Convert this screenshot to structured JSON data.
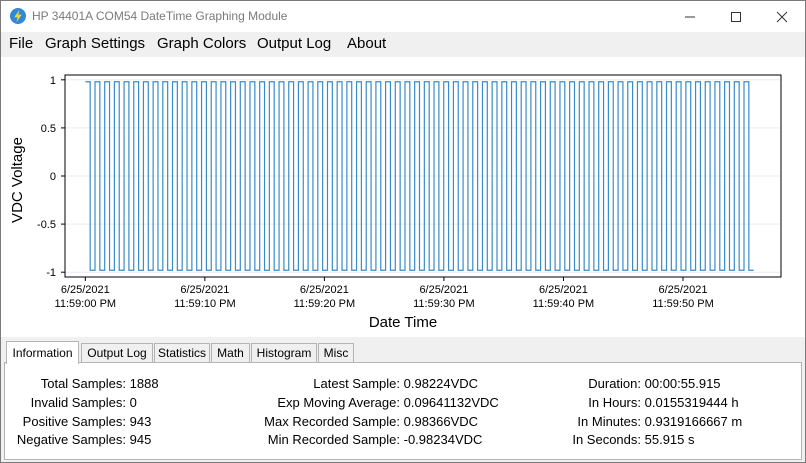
{
  "window": {
    "title": "HP 34401A COM54 DateTime Graphing Module",
    "icon": "lightning-bolt-icon",
    "controls": [
      "minimize-icon",
      "maximize-icon",
      "close-icon"
    ]
  },
  "menu": [
    "File",
    "Graph Settings",
    "Graph Colors",
    "Output Log",
    "About"
  ],
  "chart_data": {
    "type": "line",
    "xlabel": "Date Time",
    "ylabel": "VDC Voltage",
    "ylim": [
      -1.05,
      1.05
    ],
    "y_ticks": [
      "1",
      "0.5",
      "0",
      "-0.5",
      "-1"
    ],
    "x_tick_labels": [
      [
        "6/25/2021",
        "11:59:00 PM"
      ],
      [
        "6/25/2021",
        "11:59:10 PM"
      ],
      [
        "6/25/2021",
        "11:59:20 PM"
      ],
      [
        "6/25/2021",
        "11:59:30 PM"
      ],
      [
        "6/25/2021",
        "11:59:40 PM"
      ],
      [
        "6/25/2021",
        "11:59:50 PM"
      ]
    ],
    "xlim_seconds": [
      -1.7,
      58.2
    ],
    "x_tick_seconds": [
      0,
      10,
      20,
      30,
      40,
      50
    ],
    "series_start_seconds": 0,
    "series_end_seconds": 55.915,
    "grid": true,
    "series": [
      {
        "wave": "square",
        "high": 0.98,
        "low": -0.98,
        "cycles": 69,
        "color": "#3a8cc8"
      }
    ]
  },
  "tabs": [
    "Information",
    "Output Log",
    "Statistics",
    "Math",
    "Histogram",
    "Misc"
  ],
  "active_tab": "Information",
  "info": {
    "col1": [
      {
        "label": "Total Samples:",
        "value": "1888"
      },
      {
        "label": "Invalid Samples:",
        "value": "0"
      },
      {
        "label": "Positive Samples:",
        "value": "943"
      },
      {
        "label": "Negative Samples:",
        "value": "945"
      }
    ],
    "col2": [
      {
        "label": "Latest Sample:",
        "value": "0.98224VDC"
      },
      {
        "label": "Exp Moving Average:",
        "value": "0.09641132VDC"
      },
      {
        "label": "Max Recorded Sample:",
        "value": "0.98366VDC"
      },
      {
        "label": "Min Recorded Sample:",
        "value": "-0.98234VDC"
      }
    ],
    "col3": [
      {
        "label": "Duration:",
        "value": "00:00:55.915"
      },
      {
        "label": "In Hours:",
        "value": "0.0155319444 h"
      },
      {
        "label": "In Minutes:",
        "value": "0.9319166667 m"
      },
      {
        "label": "In Seconds:",
        "value": "55.915 s"
      }
    ]
  },
  "colors": {
    "series": "#3a8cc8",
    "grid": "#e6eef5",
    "frame": "#000000",
    "title_text": "#7a7a7a"
  }
}
